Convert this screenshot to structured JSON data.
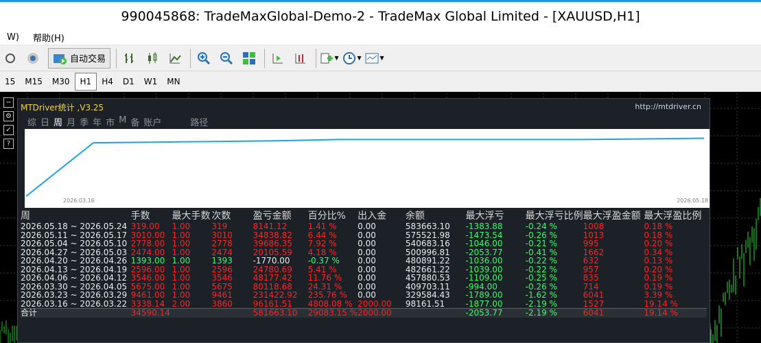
{
  "window": {
    "title": "990045868: TradeMaxGlobal-Demo-2 - TradeMax Global Limited - [XAUUSD,H1]"
  },
  "menu": [
    "W)",
    "帮助(H)"
  ],
  "toolbar": {
    "auto_trade_label": "自动交易"
  },
  "timeframes": [
    "15",
    "M15",
    "M30",
    "H1",
    "H4",
    "D1",
    "W1",
    "MN"
  ],
  "active_timeframe": "H1",
  "panel": {
    "header": "MTDriver统计 ,V3.25",
    "url": "http://mtdriver.cn",
    "tabs": [
      "综",
      "日",
      "周",
      "月",
      "季",
      "年",
      "市",
      "M",
      "备",
      "账户",
      "路径"
    ],
    "active_tab": "周",
    "chart_dates": {
      "start": "2026.03.16",
      "end": "2026.05.18"
    }
  },
  "chart_data": {
    "type": "line",
    "series": [
      {
        "values": [
          0.02,
          0.85,
          0.86,
          0.87,
          0.88,
          0.9,
          0.9,
          0.9,
          0.9,
          0.9,
          0.91,
          0.92
        ]
      }
    ],
    "line_color": "#1aa3e8"
  },
  "table": {
    "headers": [
      "周",
      "手数",
      "最大手数",
      "次数",
      "盈亏金额",
      "百分比%",
      "出入金",
      "余额",
      "最大浮亏",
      "最大浮亏比例",
      "最大浮盈金额",
      "最大浮盈比例"
    ],
    "rows": [
      [
        "2026.05.18 ~ 2026.05.24",
        "319.00",
        "1.00",
        "319",
        "8141.12",
        "1.41 %",
        "0.00",
        "583663.10",
        "-1383.88",
        "-0.24 %",
        "1008",
        "0.18 %"
      ],
      [
        "2026.05.11 ~ 2026.05.17",
        "3010.00",
        "1.00",
        "3010",
        "34838.82",
        "6.44 %",
        "0.00",
        "575521.98",
        "-1473.54",
        "-0.26 %",
        "1013",
        "0.18 %"
      ],
      [
        "2026.05.04 ~ 2026.05.10",
        "2778.00",
        "1.00",
        "2778",
        "39686.35",
        "7.92 %",
        "0.00",
        "540683.16",
        "-1046.00",
        "-0.21 %",
        "995",
        "0.20 %"
      ],
      [
        "2026.04.27 ~ 2026.05.03",
        "2474.00",
        "1.00",
        "2474",
        "20105.59",
        "4.18 %",
        "0.00",
        "500996.81",
        "-2053.77",
        "-0.41 %",
        "1662",
        "0.34 %"
      ],
      [
        "2026.04.20 ~ 2026.04.26",
        "1393.00",
        "1.00",
        "1393",
        "-1770.00",
        "-0.37 %",
        "0.00",
        "480891.22",
        "-1036.00",
        "-0.22 %",
        "632",
        "0.13 %"
      ],
      [
        "2026.04.13 ~ 2026.04.19",
        "2596.00",
        "1.00",
        "2596",
        "24780.69",
        "5.41 %",
        "0.00",
        "482661.22",
        "-1039.00",
        "-0.22 %",
        "957",
        "0.20 %"
      ],
      [
        "2026.04.06 ~ 2026.04.12",
        "3546.00",
        "1.00",
        "3546",
        "48177.42",
        "11.76 %",
        "0.00",
        "457880.53",
        "-1109.00",
        "-0.25 %",
        "835",
        "0.19 %"
      ],
      [
        "2026.03.30 ~ 2026.04.05",
        "5675.00",
        "1.00",
        "5675",
        "80118.68",
        "24.31 %",
        "0.00",
        "409703.11",
        "-994.00",
        "-0.26 %",
        "714",
        "0.19 %"
      ],
      [
        "2026.03.23 ~ 2026.03.29",
        "9461.00",
        "1.00",
        "9461",
        "231422.92",
        "235.76 %",
        "0.00",
        "329584.43",
        "-1789.00",
        "-1.62 %",
        "6041",
        "3.39 %"
      ],
      [
        "2026.03.16 ~ 2026.03.22",
        "3338.14",
        "2.00",
        "3860",
        "96161.51",
        "4808.08 %",
        "2000.00",
        "98161.51",
        "-1877.00",
        "-2.19 %",
        "1527",
        "19.14 %"
      ]
    ],
    "row_colors": [
      [
        "w",
        "r",
        "r",
        "r",
        "r",
        "r",
        "w",
        "w",
        "g",
        "g",
        "r",
        "r"
      ],
      [
        "w",
        "r",
        "r",
        "r",
        "r",
        "r",
        "w",
        "w",
        "g",
        "g",
        "r",
        "r"
      ],
      [
        "w",
        "r",
        "r",
        "r",
        "r",
        "r",
        "w",
        "w",
        "g",
        "g",
        "r",
        "r"
      ],
      [
        "w",
        "r",
        "r",
        "r",
        "r",
        "r",
        "w",
        "w",
        "g",
        "g",
        "r",
        "r"
      ],
      [
        "w",
        "g",
        "g",
        "g",
        "w",
        "g",
        "w",
        "w",
        "g",
        "g",
        "r",
        "r"
      ],
      [
        "w",
        "r",
        "r",
        "r",
        "r",
        "r",
        "w",
        "w",
        "g",
        "g",
        "r",
        "r"
      ],
      [
        "w",
        "r",
        "r",
        "r",
        "r",
        "r",
        "w",
        "w",
        "g",
        "g",
        "r",
        "r"
      ],
      [
        "w",
        "r",
        "r",
        "r",
        "r",
        "r",
        "w",
        "w",
        "g",
        "g",
        "r",
        "r"
      ],
      [
        "w",
        "r",
        "r",
        "r",
        "r",
        "r",
        "w",
        "w",
        "g",
        "g",
        "r",
        "r"
      ],
      [
        "w",
        "r",
        "r",
        "r",
        "r",
        "r",
        "r",
        "w",
        "g",
        "g",
        "r",
        "r"
      ]
    ],
    "total": [
      "合计",
      "34590.14",
      "",
      "",
      "581663.10",
      "29083.15 %",
      "2000.00",
      "",
      "-2053.77",
      "-2.19 %",
      "6041",
      "19.14 %"
    ],
    "total_colors": [
      "w",
      "r",
      "w",
      "w",
      "r",
      "r",
      "r",
      "w",
      "g",
      "g",
      "r",
      "r"
    ]
  },
  "colors": {
    "red": "#ff2222",
    "green": "#33ff66",
    "panel_bg": "#1b2126",
    "line": "#1aa3e8",
    "header": "#f5d43b"
  }
}
